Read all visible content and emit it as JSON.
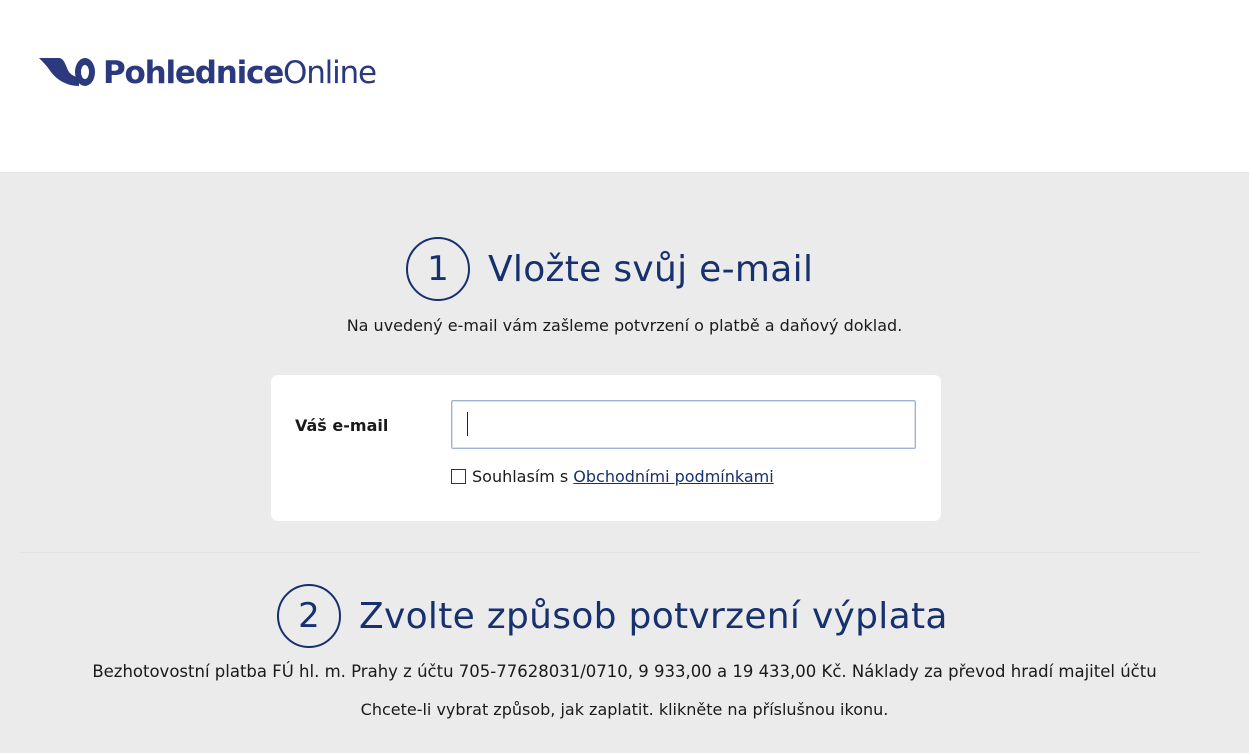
{
  "header": {
    "logo_bold": "Pohlednice",
    "logo_light": "Online"
  },
  "step1": {
    "number": "1",
    "title": "Vložte svůj e-mail",
    "description": "Na uvedený e-mail vám zašleme potvrzení o platbě a daňový doklad.",
    "email_label": "Váš e-mail",
    "email_value": "",
    "email_placeholder": "",
    "agree_text": "Souhlasím s",
    "agree_link": "Obchodními podmínkami"
  },
  "step2": {
    "number": "2",
    "title": "Zvolte způsob potvrzení výplata",
    "line1": "Bezhotovostní platba FÚ hl. m. Prahy z účtu 705-77628031/0710, 9 933,00 a 19 433,00 Kč. Náklady za převod hradí majitel účtu",
    "line2": "Chcete-li vybrat způsob, jak zaplatit. klikněte na příslušnou ikonu."
  },
  "colors": {
    "brand": "#17306e",
    "logo": "#2b3a7f",
    "background": "#ebebeb"
  }
}
